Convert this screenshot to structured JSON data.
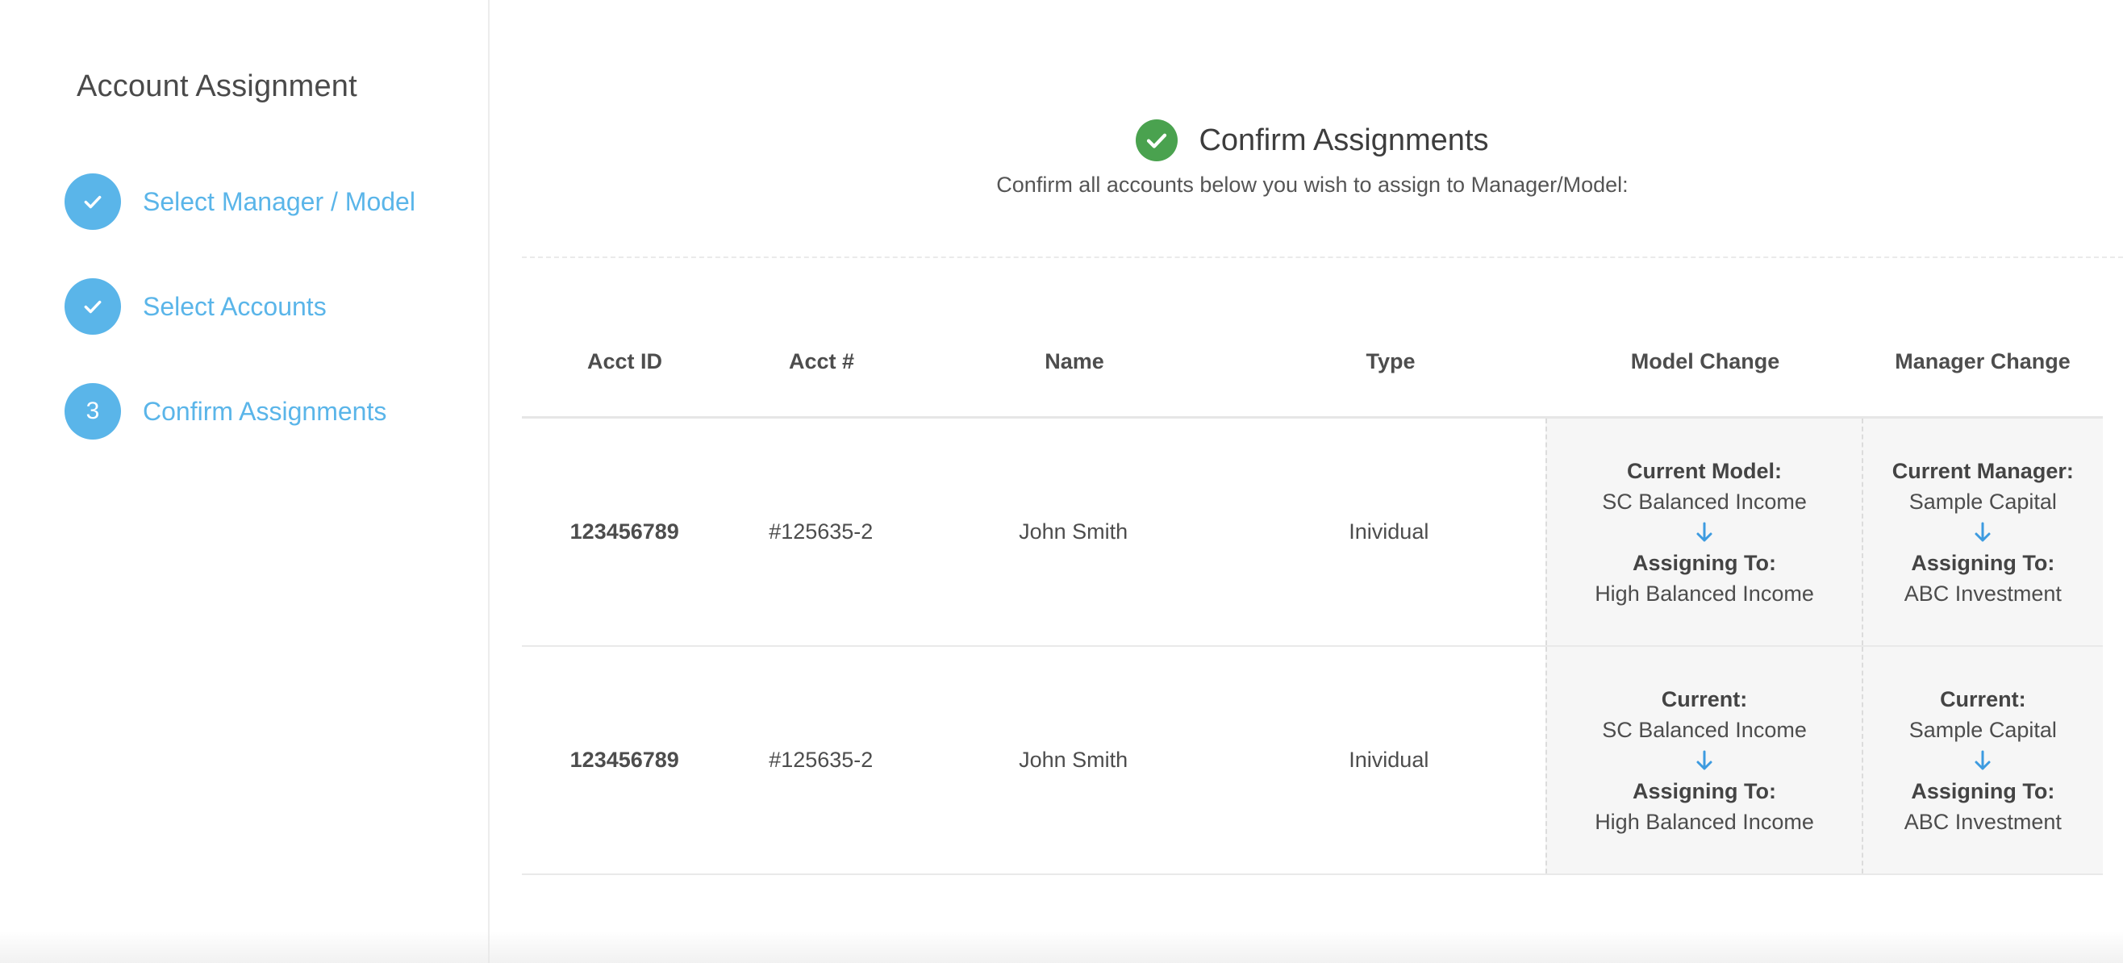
{
  "sidebar": {
    "title": "Account Assignment",
    "steps": [
      {
        "marker": "",
        "label": "Select Manager / Model",
        "state": "complete"
      },
      {
        "marker": "",
        "label": "Select Accounts",
        "state": "complete"
      },
      {
        "marker": "3",
        "label": "Confirm Assignments",
        "state": "current"
      }
    ]
  },
  "header": {
    "title": "Confirm Assignments",
    "subtitle": "Confirm all accounts below you wish to assign to Manager/Model:",
    "icon": "check-circle-icon"
  },
  "table": {
    "columns": [
      "Acct ID",
      "Acct #",
      "Name",
      "Type",
      "Model Change",
      "Manager Change"
    ],
    "rows": [
      {
        "acct_id": "123456789",
        "acct_num": "#125635-2",
        "name": "John Smith",
        "type": "Inividual",
        "model_current_label": "Current Model:",
        "model_current": "SC Balanced Income",
        "model_assign_label": "Assigning To:",
        "model_assign": "High Balanced Income",
        "manager_current_label": "Current Manager:",
        "manager_current": "Sample Capital",
        "manager_assign_label": "Assigning To:",
        "manager_assign": "ABC Investment"
      },
      {
        "acct_id": "123456789",
        "acct_num": "#125635-2",
        "name": "John Smith",
        "type": "Inividual",
        "model_current_label": "Current:",
        "model_current": "SC Balanced Income",
        "model_assign_label": "Assigning To:",
        "model_assign": "High Balanced Income",
        "manager_current_label": "Current:",
        "manager_current": "Sample Capital",
        "manager_assign_label": "Assigning To:",
        "manager_assign": "ABC Investment"
      }
    ]
  },
  "colors": {
    "accent": "#5ab5e9",
    "success": "#4aa24f",
    "arrow": "#3d9be0"
  }
}
